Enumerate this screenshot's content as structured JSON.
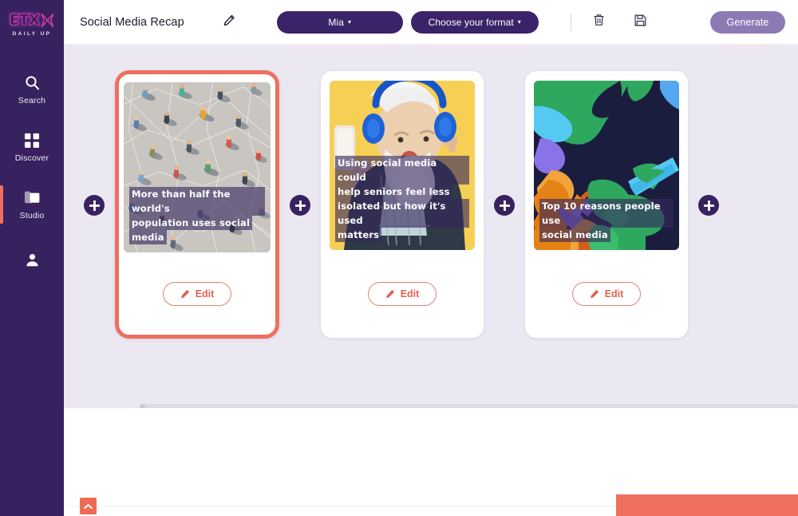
{
  "sidebar": {
    "logo": {
      "mark": "ETX",
      "tagline": "DAILY UP"
    },
    "items": [
      {
        "label": "Search",
        "icon": "search-icon",
        "active": false
      },
      {
        "label": "Discover",
        "icon": "grid-icon",
        "active": false
      },
      {
        "label": "Studio",
        "icon": "folder-icon",
        "active": true
      },
      {
        "label": "",
        "icon": "user-icon",
        "active": false
      }
    ]
  },
  "header": {
    "doc_title": "Social Media Recap",
    "edit_title_icon": "pencil-icon",
    "voice_select": {
      "label": "Mia",
      "caret": "▾"
    },
    "format_select": {
      "label": "Choose your format",
      "caret": "▾"
    },
    "delete_icon": "trash-icon",
    "save_icon": "floppy-disk-icon",
    "generate_label": "Generate"
  },
  "canvas": {
    "add_button_label": "+",
    "cards": [
      {
        "caption_lines": [
          "More than half the world's",
          "population uses social",
          "media"
        ],
        "edit_label": "Edit",
        "edit_icon": "pencil-icon",
        "media": "aerial-crowd-network-photo",
        "selected": true
      },
      {
        "caption_lines": [
          "Using social media could",
          "help seniors feel less",
          "isolated but how it's used",
          "matters"
        ],
        "edit_label": "Edit",
        "edit_icon": "pencil-icon",
        "media": "senior-man-headphones-yellow-photo",
        "selected": false
      },
      {
        "caption_lines": [
          "Top 10 reasons people use",
          "social media"
        ],
        "edit_label": "Edit",
        "edit_icon": "pencil-icon",
        "media": "abstract-posterized-phone-illustration",
        "selected": false
      }
    ]
  },
  "footer": {
    "scroll_top_icon": "chevron-up-icon"
  },
  "colors": {
    "sidebar": "#37215e",
    "accent_coral": "#ef7060",
    "canvas_bg": "#ece8f2",
    "pill_purple": "#3a2368",
    "generate_purple": "#8c7ab5"
  }
}
